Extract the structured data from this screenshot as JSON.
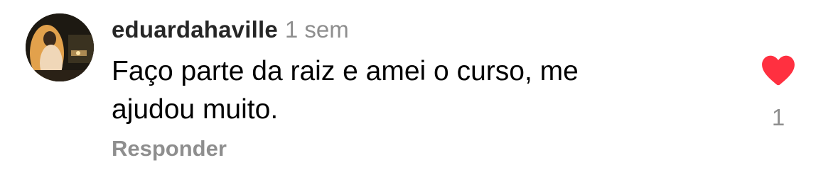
{
  "comment": {
    "username": "eduardahaville",
    "time": "1 sem",
    "text": "Faço parte da raiz e amei o curso, me ajudou muito.",
    "reply_label": "Responder",
    "like_count": "1",
    "liked": true
  },
  "icons": {
    "like": "heart-icon",
    "avatar": "profile-photo"
  },
  "colors": {
    "heart": "#ff3040",
    "secondary_text": "#8e8e8e",
    "primary_text": "#262626"
  }
}
